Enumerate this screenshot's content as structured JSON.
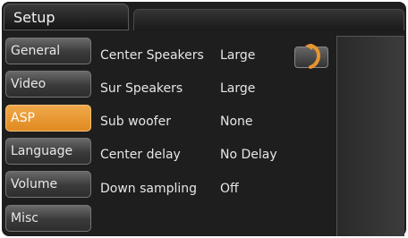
{
  "window": {
    "title": "Setup"
  },
  "sidebar": {
    "items": [
      {
        "label": "General",
        "active": false
      },
      {
        "label": "Video",
        "active": false
      },
      {
        "label": "ASP",
        "active": true
      },
      {
        "label": "Language",
        "active": false
      },
      {
        "label": "Volume",
        "active": false
      },
      {
        "label": "Misc",
        "active": false
      }
    ]
  },
  "settings": [
    {
      "label": "Center Speakers",
      "value": "Large"
    },
    {
      "label": "Sur Speakers",
      "value": "Large"
    },
    {
      "label": "Sub woofer",
      "value": "None"
    },
    {
      "label": "Center delay",
      "value": "No Delay"
    },
    {
      "label": "Down sampling",
      "value": "Off"
    }
  ],
  "controls": {
    "back_icon": "return-arrow-icon"
  },
  "colors": {
    "accent": "#e8952f",
    "background": "#1e1e1e",
    "text": "#e6e6e6"
  }
}
